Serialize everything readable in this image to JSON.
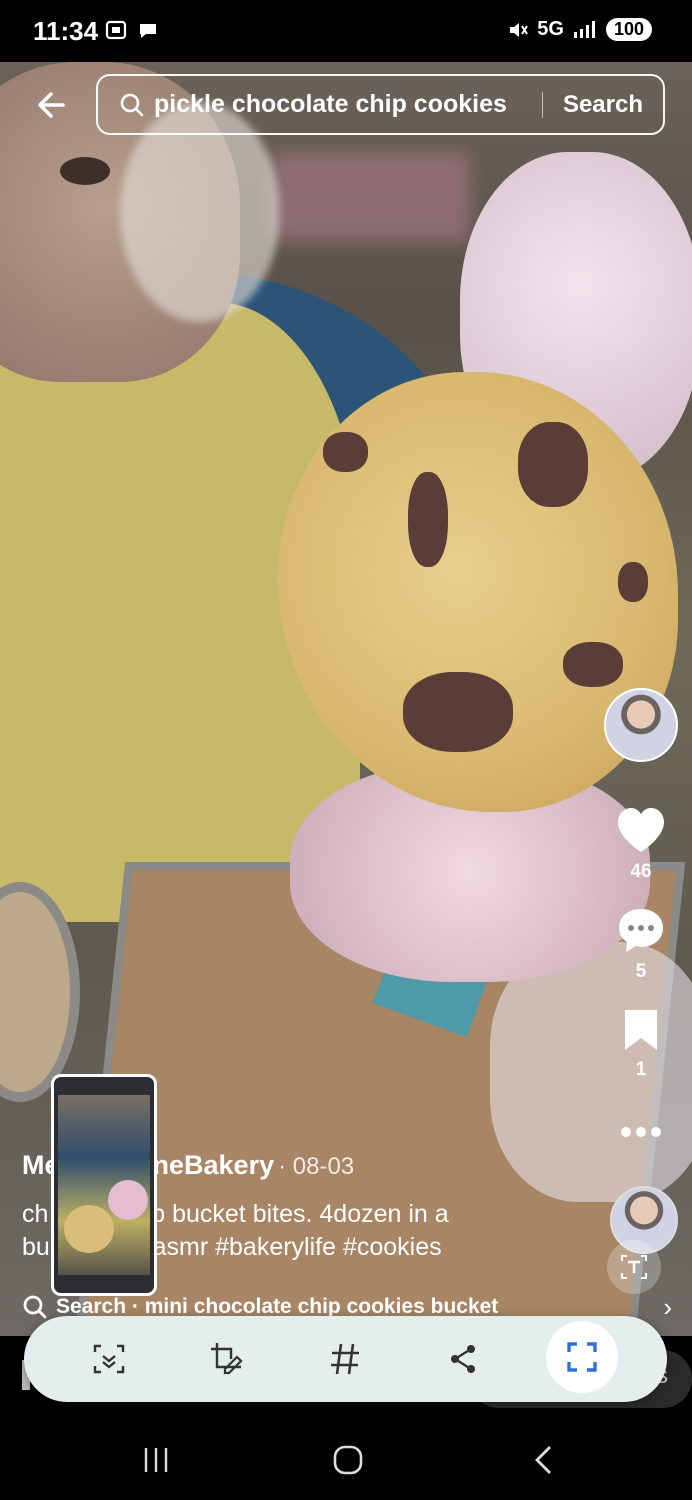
{
  "status_bar": {
    "time": "11:34",
    "network": "5G",
    "battery": "100"
  },
  "search": {
    "query": "pickle chocolate chip cookies",
    "button_label": "Search"
  },
  "post": {
    "author": "Me     nshineBakery",
    "date": "· 08-03",
    "caption_line1": "ch     hip pop bucket bites. 4dozen in a",
    "caption_line2": "bu     kery #asmr #bakerylife #cookies",
    "likes": "46",
    "comments": "5",
    "saves": "1"
  },
  "suggestion": {
    "text": "Search · mini chocolate chip cookies bucket"
  },
  "peek": {
    "partial_text": "s"
  },
  "colors": {
    "toolbar_bg": "#e4eeec",
    "accent_blue": "#2f6fe0"
  }
}
